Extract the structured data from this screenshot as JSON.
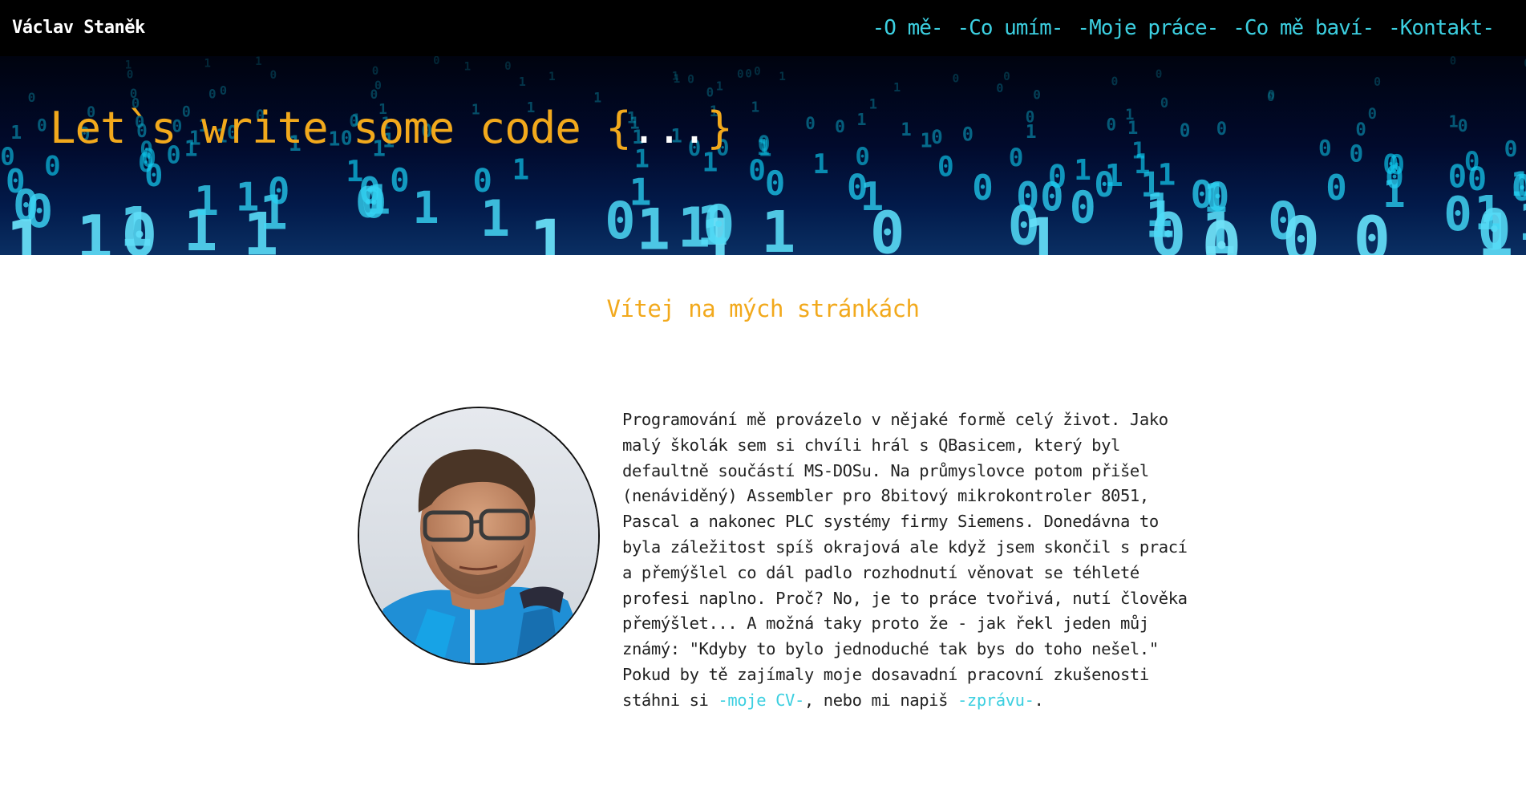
{
  "header": {
    "brand": "Václav Staněk",
    "nav": [
      {
        "label": "-O mě-"
      },
      {
        "label": "-Co umím-"
      },
      {
        "label": "-Moje práce-"
      },
      {
        "label": "-Co mě baví-"
      },
      {
        "label": "-Kontakt-"
      }
    ]
  },
  "hero": {
    "title_prefix": "Let`s write some code ",
    "brace_open": "{",
    "dots": "...",
    "brace_close": "}",
    "background_icon": "binary-code-pattern"
  },
  "main": {
    "welcome": "Vítej na mých stránkách",
    "avatar_icon": "profile-photo",
    "bio_lines": [
      "Programování mě provázelo v nějaké formě celý život. Jako",
      "malý školák sem si chvíli hrál s QBasicem, který byl",
      "defaultně součástí MS-DOSu. Na průmyslovce potom přišel",
      "(nenáviděný) Assembler pro 8bitový mikrokontroler 8051,",
      "Pascal a nakonec PLC systémy firmy Siemens. Donedávna to",
      "byla záležitost spíš okrajová ale když jsem skončil s prací",
      "a přemýšlel co dál padlo rozhodnutí věnovat se téhleté",
      "profesi naplno. Proč? No, je to práce tvořivá, nutí člověka",
      "přemýšlet... A možná taky proto že - jak řekl jeden můj",
      "známý: \"Kdyby to bylo jednoduché tak bys do toho nešel.\"",
      "Pokud by tě zajímaly moje dosavadní pracovní zkušenosti"
    ],
    "last_line": {
      "before": "stáhni si ",
      "cv_link": "-moje CV-",
      "middle": ", nebo mi napiš ",
      "message_link": "-zprávu-",
      "after": "."
    }
  },
  "colors": {
    "accent": "#f2a91c",
    "link": "#3ccfe0",
    "topbar": "#000000",
    "text": "#222222"
  }
}
